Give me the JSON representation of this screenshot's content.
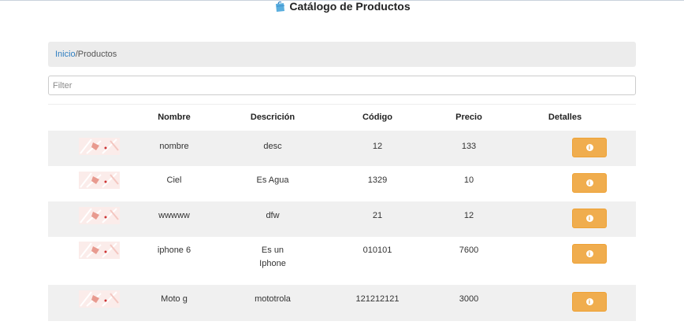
{
  "header": {
    "title": "Catálogo de Productos",
    "icon": "shopping-bag-icon"
  },
  "breadcrumb": {
    "home": "Inicio",
    "separator": "/",
    "current": "Productos"
  },
  "filter": {
    "placeholder": "Filter",
    "value": ""
  },
  "table": {
    "columns": [
      "",
      "Nombre",
      "Descrición",
      "Código",
      "Precio",
      "Detalles"
    ],
    "rows": [
      {
        "nombre": "nombre",
        "descripcion": "desc",
        "codigo": "12",
        "precio": "133"
      },
      {
        "nombre": "Ciel",
        "descripcion": "Es Agua",
        "codigo": "1329",
        "precio": "10"
      },
      {
        "nombre": "wwwww",
        "descripcion": "dfw",
        "codigo": "21",
        "precio": "12"
      },
      {
        "nombre": "iphone 6",
        "descripcion": "Es un Iphone",
        "codigo": "010101",
        "precio": "7600"
      },
      {
        "nombre": "Moto g",
        "descripcion": "mototrola",
        "codigo": "121212121",
        "precio": "3000"
      }
    ],
    "detail_button_icon": "info-icon",
    "detail_icon_glyph": "i"
  },
  "colors": {
    "accent": "#f0ad4e",
    "link": "#2f7fc1",
    "stripe": "#f0f0f0"
  }
}
